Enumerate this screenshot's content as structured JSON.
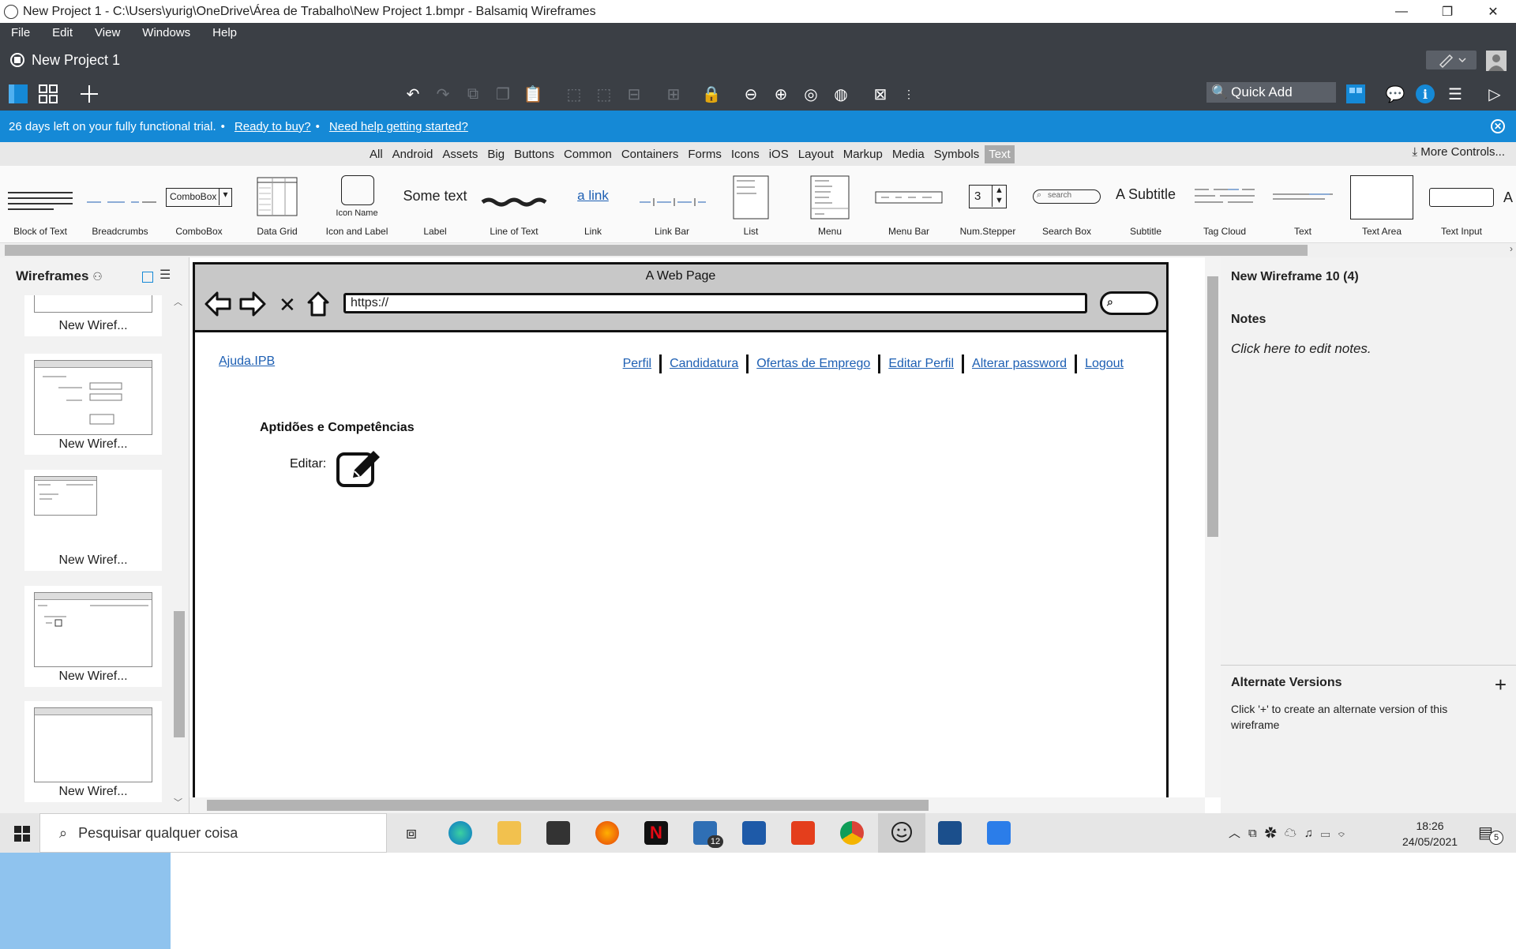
{
  "window": {
    "title": "New Project 1 - C:\\Users\\yurig\\OneDrive\\Área de Trabalho\\New Project 1.bmpr - Balsamiq Wireframes",
    "minimize": "—",
    "restore": "❐",
    "close": "✕"
  },
  "menu": [
    "File",
    "Edit",
    "View",
    "Windows",
    "Help"
  ],
  "project": {
    "name": "New Project 1"
  },
  "toolbar": {
    "quick_add_placeholder": "Quick Add"
  },
  "trial": {
    "message": "26 days left on your fully functional trial.",
    "buy_link": "Ready to buy?",
    "help_link": "Need help getting started?"
  },
  "library_tabs": {
    "tabs": [
      "All",
      "Android",
      "Assets",
      "Big",
      "Buttons",
      "Common",
      "Containers",
      "Forms",
      "Icons",
      "iOS",
      "Layout",
      "Markup",
      "Media",
      "Symbols",
      "Text"
    ],
    "selected": "Text",
    "more_controls": "More Controls..."
  },
  "palette": {
    "items": [
      {
        "label": "Block of Text"
      },
      {
        "label": "Breadcrumbs"
      },
      {
        "label": "ComboBox",
        "preview": "ComboBox"
      },
      {
        "label": "Data Grid"
      },
      {
        "label": "Icon and Label",
        "preview": "Icon Name"
      },
      {
        "label": "Label",
        "preview": "Some text"
      },
      {
        "label": "Line of Text"
      },
      {
        "label": "Link",
        "preview": "a link"
      },
      {
        "label": "Link Bar"
      },
      {
        "label": "List"
      },
      {
        "label": "Menu"
      },
      {
        "label": "Menu Bar"
      },
      {
        "label": "Num.Stepper",
        "preview": "3"
      },
      {
        "label": "Search Box",
        "preview": "search"
      },
      {
        "label": "Subtitle",
        "preview": "A Subtitle"
      },
      {
        "label": "Tag Cloud"
      },
      {
        "label": "Text"
      },
      {
        "label": "Text Area"
      },
      {
        "label": "Text Input"
      }
    ]
  },
  "wireframes_panel": {
    "title": "Wireframes",
    "items": [
      "New Wiref...",
      "New Wiref...",
      "New Wiref...",
      "New Wiref...",
      "New Wiref..."
    ]
  },
  "canvas": {
    "browser_title": "A Web Page",
    "url": "https://",
    "brand_link": "Ajuda.IPB",
    "nav_links": [
      "Perfil",
      "Candidatura",
      "Ofertas de Emprego",
      "Editar Perfil",
      "Alterar password",
      "Logout"
    ],
    "section_title": "Aptidões e Competências",
    "edit_label": "Editar:"
  },
  "inspector": {
    "title": "New Wireframe 10 (4)",
    "notes_header": "Notes",
    "notes_placeholder": "Click here to edit notes.",
    "alt_header": "Alternate Versions",
    "alt_add": "+",
    "alt_text": "Click '+' to create an alternate version of this wireframe"
  },
  "taskbar": {
    "search_placeholder": "Pesquisar qualquer coisa",
    "mail_badge": "12",
    "notif_badge": "5",
    "time": "18:26",
    "date": "24/05/2021"
  },
  "colors": {
    "accent": "#1589d6",
    "chrome": "#3b3f45",
    "link": "#1d5fb3"
  }
}
